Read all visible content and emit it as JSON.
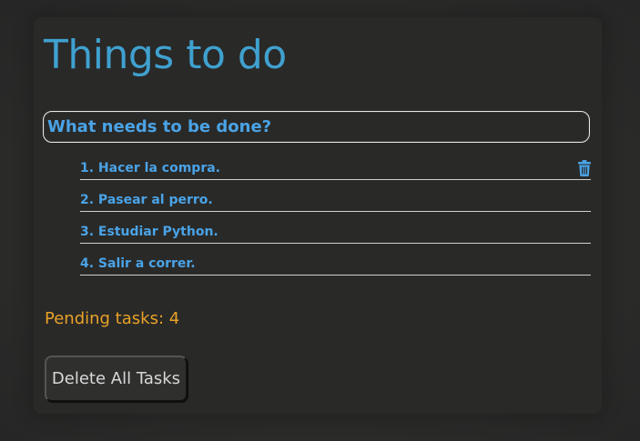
{
  "header": {
    "title": "Things to do"
  },
  "new_task": {
    "placeholder": "What needs to be done?",
    "value": ""
  },
  "tasks": [
    {
      "label": "1. Hacer la compra.",
      "show_delete": true
    },
    {
      "label": "2. Pasear al perro.",
      "show_delete": false
    },
    {
      "label": "3. Estudiar Python.",
      "show_delete": false
    },
    {
      "label": "4. Salir a correr.",
      "show_delete": false
    }
  ],
  "footer": {
    "pending_text": "Pending tasks: 4",
    "delete_all_label": "Delete All Tasks"
  },
  "colors": {
    "title": "#3fa1cf",
    "task_text": "#4aa3e6",
    "pending": "#e9a227",
    "background": "#292928"
  },
  "icons": {
    "delete_task": "trash-icon"
  }
}
